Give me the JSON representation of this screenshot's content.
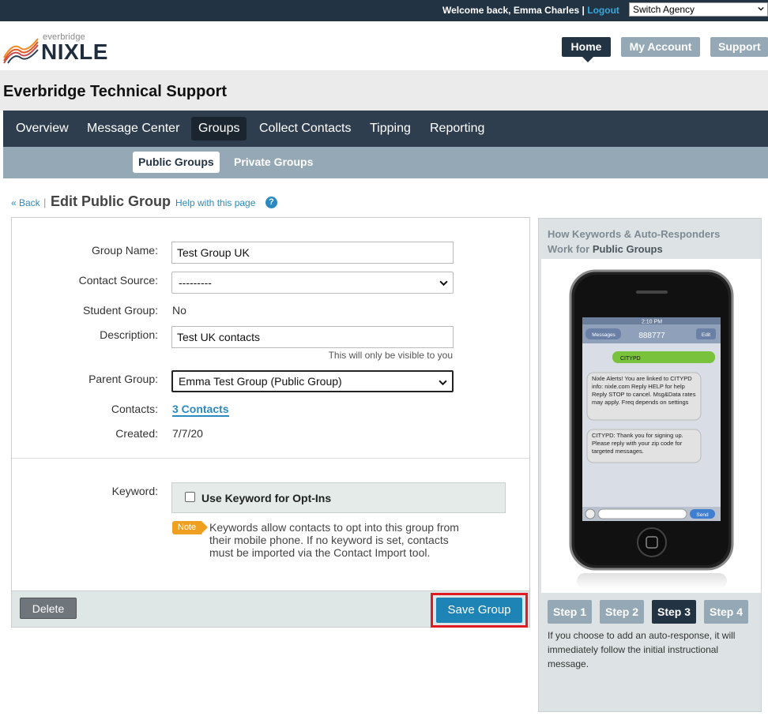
{
  "topbar": {
    "welcome": "Welcome back, Emma Charles",
    "separator": "|",
    "logout": "Logout",
    "switch_agency": "Switch Agency"
  },
  "header": {
    "logo_small": "everbridge",
    "logo_big": "NIXLE",
    "nav": {
      "home": "Home",
      "my_account": "My Account",
      "support": "Support"
    }
  },
  "agency_title": "Everbridge Technical Support",
  "main_nav": [
    "Overview",
    "Message Center",
    "Groups",
    "Collect Contacts",
    "Tipping",
    "Reporting"
  ],
  "main_nav_active": "Groups",
  "sub_nav": [
    "Public Groups",
    "Private Groups"
  ],
  "sub_nav_active": "Public Groups",
  "page": {
    "back": "« Back",
    "separator": "|",
    "title": "Edit Public Group",
    "help": "Help with this page",
    "help_icon": "?"
  },
  "form": {
    "group_name_label": "Group Name:",
    "group_name_value": "Test Group UK",
    "contact_source_label": "Contact Source:",
    "contact_source_value": "---------",
    "student_group_label": "Student Group:",
    "student_group_value": "No",
    "description_label": "Description:",
    "description_value": "Test UK contacts",
    "description_hint": "This will only be visible to you",
    "parent_group_label": "Parent Group:",
    "parent_group_value": "Emma Test Group (Public Group)",
    "contacts_label": "Contacts:",
    "contacts_value": "3 Contacts",
    "created_label": "Created:",
    "created_value": "7/7/20",
    "keyword_label": "Keyword:",
    "keyword_checkbox_label": "Use Keyword for Opt-Ins",
    "keyword_checked": false,
    "note_badge": "Note",
    "note_text": "Keywords allow contacts to opt into this group from their mobile phone. If no keyword is set, contacts must be imported via the Contact Import tool.",
    "delete_button": "Delete",
    "save_button": "Save Group"
  },
  "right_panel": {
    "title_prefix": "How Keywords & Auto-Responders Work for",
    "title_bold": "Public Groups",
    "phone": {
      "time": "2:10 PM",
      "back_button": "Messages",
      "contact": "888777",
      "edit_button": "Edit",
      "sent_message": "CITYPD",
      "reply1": "Nixle Alerts! You are linked to CITYPD info: nixle.com Reply HELP for help Reply STOP to cancel. Msg&Data rates may apply. Freq depends on settings",
      "reply2": "CITYPD: Thank you for signing up. Please reply with your zip code for targeted messages.",
      "send_button": "Send"
    },
    "steps": [
      "Step 1",
      "Step 2",
      "Step 3",
      "Step 4"
    ],
    "active_step": "Step 3",
    "description": "If you choose to add an auto-response, it will immediately follow the initial instructional message."
  },
  "colors": {
    "topbar": "#223344",
    "nav": "#2e3e4e",
    "subnav": "#95a8b5",
    "link": "#2a8ac0",
    "save_button": "#1d84b5",
    "highlight_outline": "#e01b24",
    "note_badge": "#f0a020"
  },
  "icons": [
    "nixle-logo-icon",
    "chevron-down-icon",
    "question-icon",
    "phone-illustration"
  ]
}
